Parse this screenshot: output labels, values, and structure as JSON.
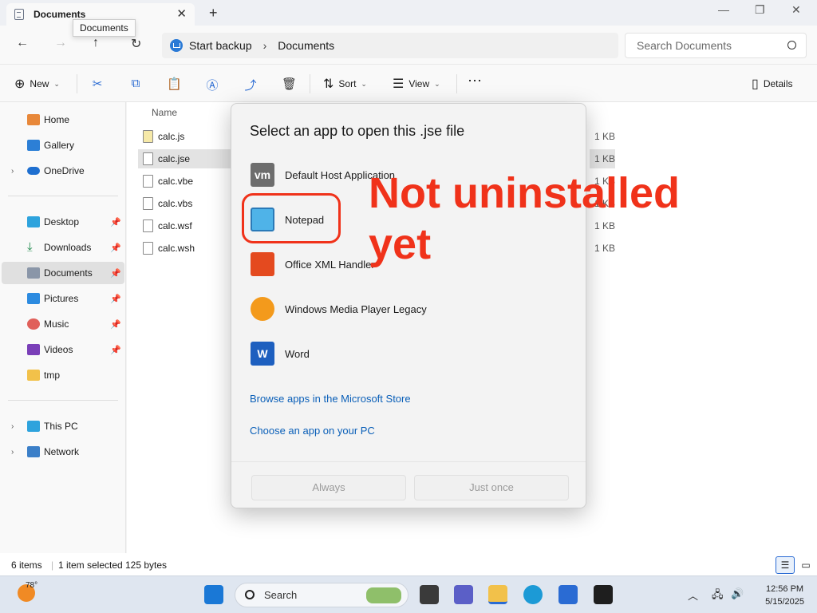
{
  "titlebar": {
    "tab_title": "Documents",
    "tooltip": "Documents"
  },
  "nav": {
    "breadcrumb": [
      "Start backup",
      "Documents"
    ],
    "search_placeholder": "Search Documents"
  },
  "commands": {
    "new": "New",
    "sort": "Sort",
    "view": "View",
    "details": "Details"
  },
  "sidebar": {
    "items": [
      {
        "label": "Home"
      },
      {
        "label": "Gallery"
      },
      {
        "label": "OneDrive"
      },
      {
        "label": "Desktop"
      },
      {
        "label": "Downloads"
      },
      {
        "label": "Documents"
      },
      {
        "label": "Pictures"
      },
      {
        "label": "Music"
      },
      {
        "label": "Videos"
      },
      {
        "label": "tmp"
      },
      {
        "label": "This PC"
      },
      {
        "label": "Network"
      }
    ]
  },
  "filelist": {
    "column_name": "Name",
    "files": [
      {
        "name": "calc.js",
        "size": "1 KB"
      },
      {
        "name": "calc.jse",
        "size": "1 KB"
      },
      {
        "name": "calc.vbe",
        "size": "1 KB"
      },
      {
        "name": "calc.vbs",
        "size": "1 KB"
      },
      {
        "name": "calc.wsf",
        "size": "1 KB"
      },
      {
        "name": "calc.wsh",
        "size": "1 KB"
      }
    ]
  },
  "status": {
    "items": "6 items",
    "selected": "1 item selected",
    "bytes": "125 bytes"
  },
  "dialog": {
    "title": "Select an app to open this .jse file",
    "apps": [
      {
        "label": "Default Host Application",
        "icon": "vmware-icon"
      },
      {
        "label": "Notepad",
        "icon": "notepad-icon"
      },
      {
        "label": "Office XML Handler",
        "icon": "office-icon"
      },
      {
        "label": "Windows Media Player Legacy",
        "icon": "media-player-icon"
      },
      {
        "label": "Word",
        "icon": "word-icon"
      }
    ],
    "store_link": "Browse apps in the Microsoft Store",
    "pc_link": "Choose an app on your PC",
    "always": "Always",
    "just_once": "Just once"
  },
  "annotation": {
    "line1": "Not uninstalled",
    "line2": "yet",
    "color": "#f0321a"
  },
  "taskbar": {
    "temperature": "78°",
    "search": "Search",
    "time": "12:56 PM",
    "date": "5/15/2025"
  }
}
